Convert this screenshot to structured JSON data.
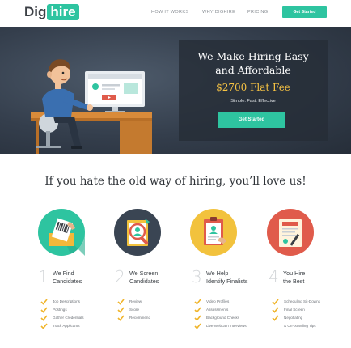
{
  "header": {
    "logo_dig": "Dig",
    "logo_hire": "hire",
    "nav": [
      "HOW IT WORKS",
      "WHY DIGHIRE",
      "PRICING"
    ],
    "cta_label": "Get Started"
  },
  "hero": {
    "title_line1": "We Make Hiring Easy",
    "title_line2": "and Affordable",
    "price": "$2700 Flat Fee",
    "subtitle": "Simple. Fast. Effective",
    "cta_label": "Get Started"
  },
  "section": {
    "title": "If you hate the old way of hiring, you’ll love us!"
  },
  "steps": [
    {
      "number": "1",
      "title_line1": "We Find",
      "title_line2": "Candidates",
      "icon": "job-posting-icon",
      "items": [
        "Job Descriptions",
        "Postings",
        "Gather Credentials",
        "Track Applicants"
      ]
    },
    {
      "number": "2",
      "title_line1": "We Screen",
      "title_line2": "Candidates",
      "icon": "screening-icon",
      "items": [
        "Review",
        "Score",
        "Recommend"
      ]
    },
    {
      "number": "3",
      "title_line1": "We Help",
      "title_line2": "Identify Finalists",
      "icon": "candidate-profile-icon",
      "items": [
        "Video Profiles",
        "Assessments",
        "Background Checks",
        "Live Webcam Interviews"
      ]
    },
    {
      "number": "4",
      "title_line1": "You Hire",
      "title_line2": "the Best",
      "icon": "contract-icon",
      "items": [
        "Scheduling Sit-Downs",
        "Final Screen",
        "Negotiating",
        "& On-boarding Tips"
      ]
    }
  ],
  "colors": {
    "accent": "#2ec4a0",
    "price": "#f7c343",
    "check": "#f0b52c",
    "hero_bg": "#343e4c"
  }
}
